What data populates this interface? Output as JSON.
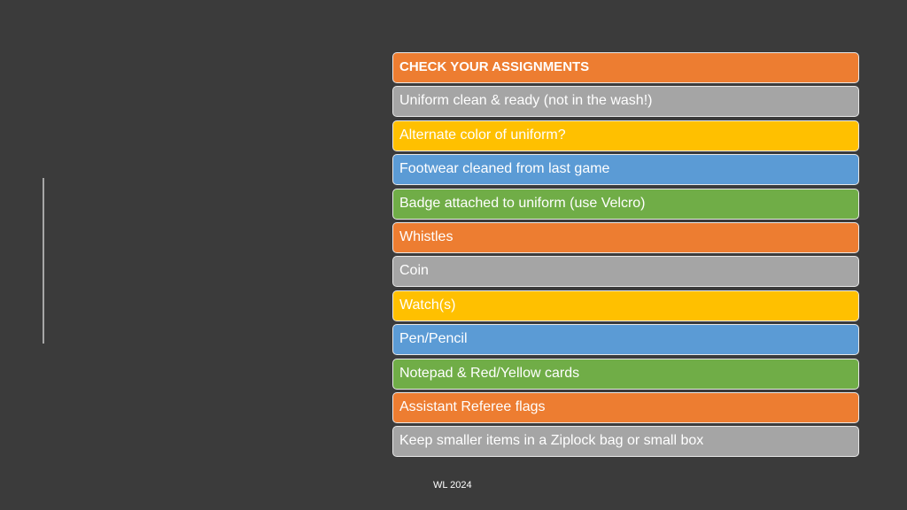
{
  "slide": {
    "title": "CHECK YOUR ASSIGNMENTS",
    "title_color": "#ed7d31",
    "items": [
      {
        "label": "Uniform clean & ready (not in the wash!)",
        "color": "#a5a5a5"
      },
      {
        "label": "Alternate color of uniform?",
        "color": "#ffc000"
      },
      {
        "label": "Footwear cleaned from last game",
        "color": "#5b9bd5"
      },
      {
        "label": "Badge attached to uniform (use Velcro)",
        "color": "#70ad47"
      },
      {
        "label": "Whistles",
        "color": "#ed7d31"
      },
      {
        "label": "Coin",
        "color": "#a5a5a5"
      },
      {
        "label": "Watch(s)",
        "color": "#ffc000"
      },
      {
        "label": "Pen/Pencil",
        "color": "#5b9bd5"
      },
      {
        "label": "Notepad & Red/Yellow cards",
        "color": "#70ad47"
      },
      {
        "label": "Assistant Referee flags",
        "color": "#ed7d31"
      },
      {
        "label": "Keep smaller items in a Ziplock bag or small box",
        "color": "#a5a5a5"
      }
    ],
    "footer": "WL 2024"
  }
}
